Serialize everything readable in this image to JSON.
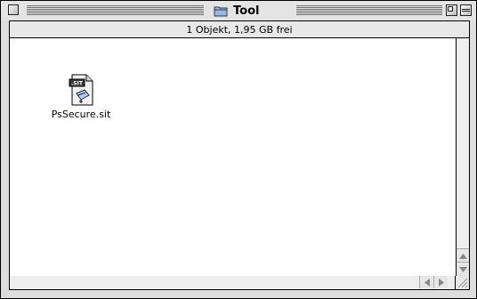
{
  "window": {
    "title": "Tool",
    "status_text": "1 Objekt, 1,95 GB frei"
  },
  "items": [
    {
      "label": "PsSecure.sit",
      "badge": ".SIT",
      "icon": "stuffit-archive-icon"
    }
  ],
  "icons": {
    "title": "folder-icon",
    "close": "close-box-icon",
    "zoom": "zoom-box-icon",
    "collapse": "collapse-box-icon"
  }
}
